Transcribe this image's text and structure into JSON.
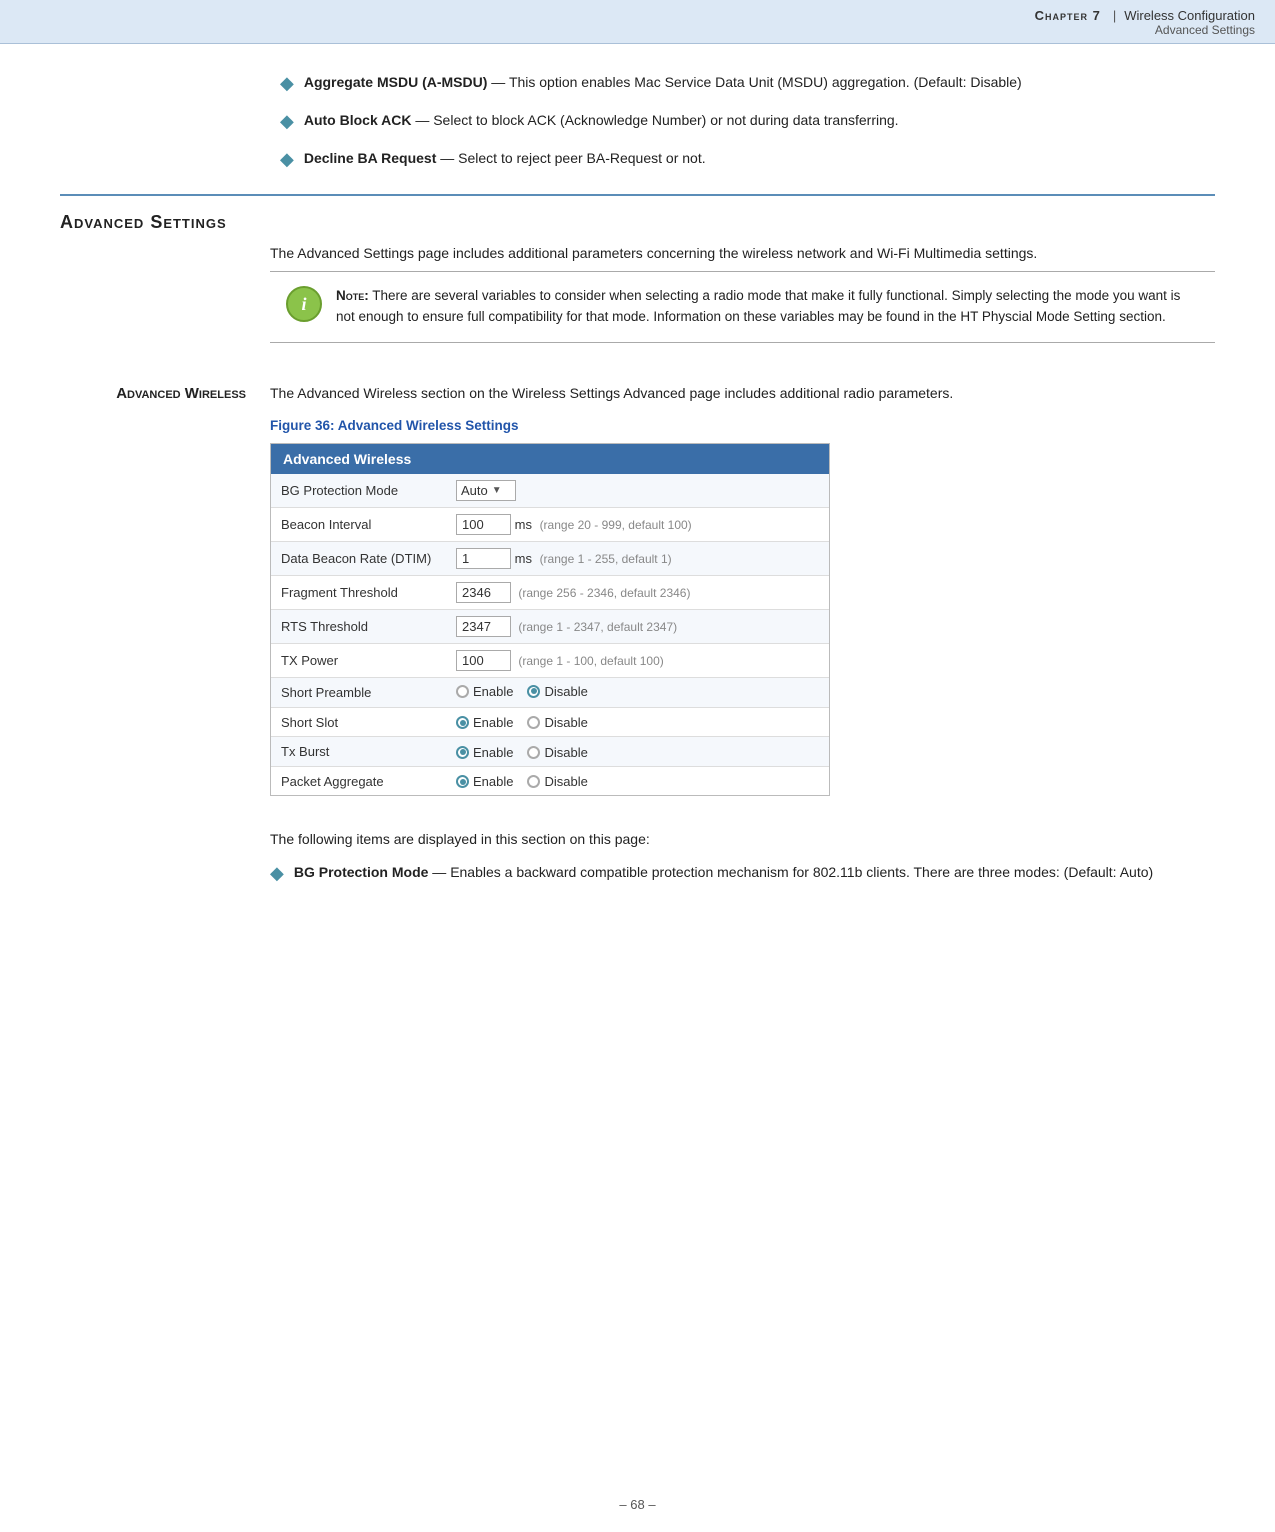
{
  "header": {
    "chapter_label": "Chapter 7",
    "separator": "|",
    "title": "Wireless Configuration",
    "subtitle": "Advanced Settings"
  },
  "bullets_top": [
    {
      "term": "Aggregate MSDU (A-MSDU)",
      "dash": "—",
      "desc": "This option enables Mac Service Data Unit (MSDU) aggregation. (Default: Disable)"
    },
    {
      "term": "Auto Block ACK",
      "dash": "—",
      "desc": "Select to block ACK (Acknowledge Number) or not during data transferring."
    },
    {
      "term": "Decline BA Request",
      "dash": "—",
      "desc": "Select to reject peer BA-Request or not."
    }
  ],
  "adv_settings": {
    "heading": "Advanced Settings",
    "description": "The Advanced Settings page includes additional parameters concerning the wireless network and Wi-Fi Multimedia settings.",
    "note_label": "Note:",
    "note_text": "There are several variables to consider when selecting a radio mode that make it fully functional. Simply selecting the mode you want is not enough to ensure full compatibility for that mode. Information on these variables may be found in the HT Physcial Mode Setting section."
  },
  "adv_wireless": {
    "heading": "Advanced Wireless",
    "description": "The Advanced Wireless section on the Wireless Settings Advanced page includes additional radio parameters.",
    "figure_caption": "Figure 36:  Advanced Wireless Settings",
    "table_header": "Advanced Wireless",
    "rows": [
      {
        "label": "BG Protection Mode",
        "type": "select",
        "value": "Auto"
      },
      {
        "label": "Beacon Interval",
        "type": "input_ms",
        "value": "100",
        "range": "(range 20 - 999, default 100)"
      },
      {
        "label": "Data Beacon Rate (DTIM)",
        "type": "input_ms",
        "value": "1",
        "range": "(range 1 - 255, default 1)"
      },
      {
        "label": "Fragment Threshold",
        "type": "input_range",
        "value": "2346",
        "range": "(range 256 - 2346, default 2346)"
      },
      {
        "label": "RTS Threshold",
        "type": "input_range",
        "value": "2347",
        "range": "(range 1 - 2347, default 2347)"
      },
      {
        "label": "TX Power",
        "type": "input_range",
        "value": "100",
        "range": "(range 1 - 100, default 100)"
      },
      {
        "label": "Short Preamble",
        "type": "radio",
        "options": [
          "Enable",
          "Disable"
        ],
        "selected": "Disable"
      },
      {
        "label": "Short Slot",
        "type": "radio",
        "options": [
          "Enable",
          "Disable"
        ],
        "selected": "Enable"
      },
      {
        "label": "Tx Burst",
        "type": "radio",
        "options": [
          "Enable",
          "Disable"
        ],
        "selected": "Enable"
      },
      {
        "label": "Packet Aggregate",
        "type": "radio",
        "options": [
          "Enable",
          "Disable"
        ],
        "selected": "Enable"
      }
    ],
    "following_text": "The following items are displayed in this section on this page:",
    "bg_bullet_term": "BG Protection Mode",
    "bg_bullet_dash": "—",
    "bg_bullet_desc": "Enables a backward compatible protection mechanism for 802.11b clients. There are three modes: (Default: Auto)"
  },
  "footer": {
    "text": "–  68  –"
  }
}
